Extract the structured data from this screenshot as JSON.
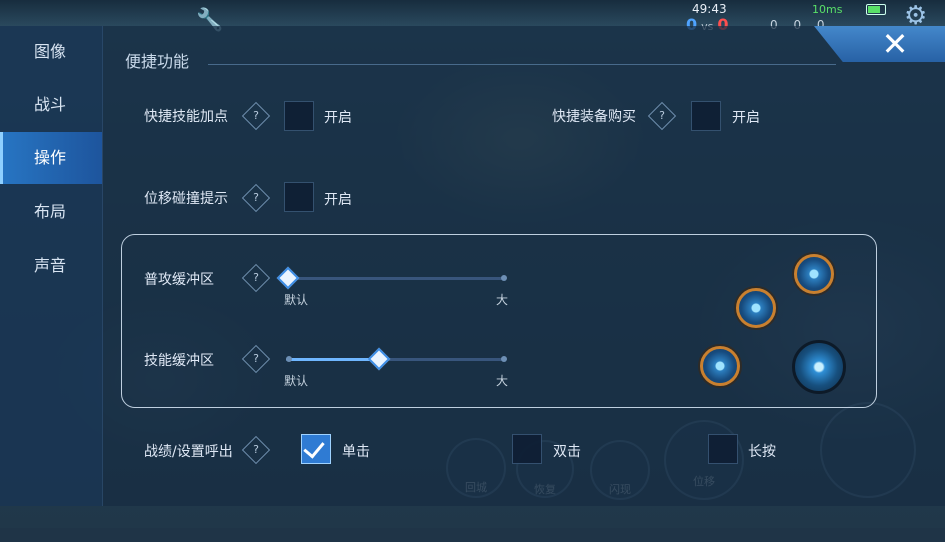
{
  "hud": {
    "time": "49:43",
    "score_blue": "0",
    "vs": "vs",
    "score_red": "0",
    "ping": "10ms",
    "counts": "0 0 0"
  },
  "sidebar": {
    "items": [
      {
        "label": "图像",
        "active": false
      },
      {
        "label": "战斗",
        "active": false
      },
      {
        "label": "操作",
        "active": true
      },
      {
        "label": "布局",
        "active": false
      },
      {
        "label": "声音",
        "active": false
      }
    ]
  },
  "section": {
    "title": "便捷功能"
  },
  "options": {
    "quick_skill": {
      "label": "快捷技能加点",
      "option": "开启",
      "checked": false
    },
    "quick_buy": {
      "label": "快捷装备购买",
      "option": "开启",
      "checked": false
    },
    "move_collision": {
      "label": "位移碰撞提示",
      "option": "开启",
      "checked": false
    }
  },
  "buffer": {
    "attack": {
      "label": "普攻缓冲区",
      "min_label": "默认",
      "max_label": "大",
      "value_fraction": 0.0
    },
    "skill": {
      "label": "技能缓冲区",
      "min_label": "默认",
      "max_label": "大",
      "value_fraction": 0.42
    }
  },
  "stats_call": {
    "label": "战绩/设置呼出",
    "options": [
      {
        "label": "单击",
        "checked": true
      },
      {
        "label": "双击",
        "checked": false
      },
      {
        "label": "长按",
        "checked": false
      }
    ]
  },
  "background_buttons": {
    "recall": "回城",
    "heal": "恢复",
    "flash": "闪现",
    "dash": "位移"
  },
  "colors": {
    "accent": "#2f7bd3",
    "active_tab": "#2878c8",
    "skill_ring": "#c9802f"
  },
  "help_glyph": "?"
}
